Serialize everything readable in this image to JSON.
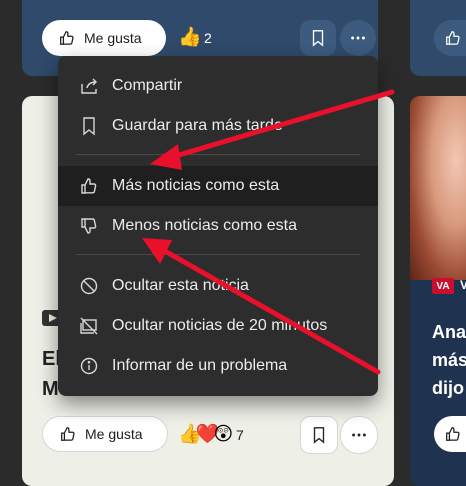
{
  "top_card": {
    "like_label": "Me gusta",
    "reaction_emoji": "👍",
    "reaction_count": "2",
    "partial_title": "..."
  },
  "context_menu": {
    "items": [
      {
        "label": "Compartir",
        "icon": "share-icon"
      },
      {
        "label": "Guardar para más tarde",
        "icon": "bookmark-icon"
      },
      {
        "label": "Más noticias como esta",
        "icon": "thumbs-up-icon"
      },
      {
        "label": "Menos noticias como esta",
        "icon": "thumbs-down-icon"
      },
      {
        "label": "Ocultar esta noticia",
        "icon": "block-icon"
      },
      {
        "label": "Ocultar noticias de 20 minutos",
        "icon": "hide-source-icon"
      },
      {
        "label": "Informar de un problema",
        "icon": "info-icon"
      }
    ]
  },
  "bottom_left_card": {
    "headline_line1": "El",
    "headline_line2": "Montero",
    "like_label": "Me gusta",
    "reaction_emojis": "👍❤️😲",
    "reaction_count": "7"
  },
  "right_card": {
    "source_badge": "VA",
    "source_letter": "V",
    "title_line1": "Ana",
    "title_line2": "más",
    "title_line3": "dijo"
  },
  "colors": {
    "menu_background": "#2d2d2d",
    "menu_highlight": "#1f1f1f",
    "card_blue": "#2f4a6a",
    "arrow_red": "#e8102a"
  }
}
